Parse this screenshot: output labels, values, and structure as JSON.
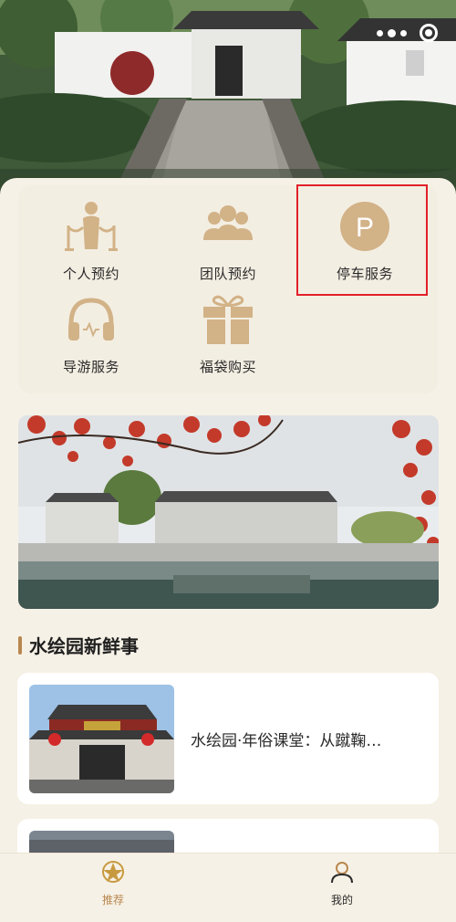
{
  "services": [
    {
      "label": "个人预约",
      "icon": "person-queue-icon"
    },
    {
      "label": "团队预约",
      "icon": "group-icon"
    },
    {
      "label": "停车服务",
      "icon": "parking-icon"
    },
    {
      "label": "导游服务",
      "icon": "headphones-icon"
    },
    {
      "label": "福袋购买",
      "icon": "gift-icon"
    }
  ],
  "section": {
    "title": "水绘园新鲜事"
  },
  "news": [
    {
      "title": "水绘园·年俗课堂：从蹴鞠…"
    },
    {
      "title": ""
    }
  ],
  "tabbar": {
    "recommend_label": "推荐",
    "mine_label": "我的"
  },
  "colors": {
    "accent_gold": "#d2b287",
    "accent_brown": "#b8874f",
    "highlight_red": "#e2202a",
    "background": "#f6f1e6"
  }
}
